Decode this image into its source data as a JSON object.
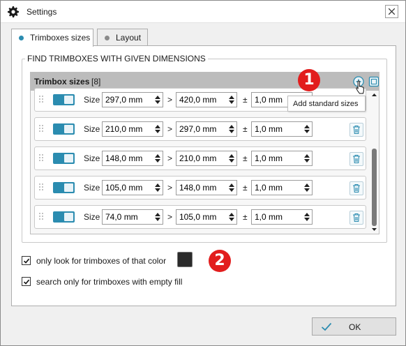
{
  "window": {
    "title": "Settings",
    "title_icon": "gear-icon",
    "close_icon": "close-icon"
  },
  "tabs": [
    {
      "label": "Trimboxes sizes",
      "active": true,
      "dot_color": "#2b8cb0"
    },
    {
      "label": "Layout",
      "active": false,
      "dot_color": "#8a8a8a"
    }
  ],
  "find_group": {
    "title": "FIND TRIMBOXES WITH GIVEN DIMENSIONS",
    "list": {
      "title": "Trimbox sizes",
      "count": "[8]",
      "add_icon": "add-circle-icon",
      "standard_icon": "add-standard-sizes-icon",
      "rows": [
        {
          "label": "Size",
          "width": "297,0 mm",
          "separator": ">",
          "height": "420,0 mm",
          "tolerance_sign": "±",
          "tolerance": "1,0 mm"
        },
        {
          "label": "Size",
          "width": "210,0 mm",
          "separator": ">",
          "height": "297,0 mm",
          "tolerance_sign": "±",
          "tolerance": "1,0 mm"
        },
        {
          "label": "Size",
          "width": "148,0 mm",
          "separator": ">",
          "height": "210,0 mm",
          "tolerance_sign": "±",
          "tolerance": "1,0 mm"
        },
        {
          "label": "Size",
          "width": "105,0 mm",
          "separator": ">",
          "height": "148,0 mm",
          "tolerance_sign": "±",
          "tolerance": "1,0 mm"
        },
        {
          "label": "Size",
          "width": "74,0 mm",
          "separator": ">",
          "height": "105,0 mm",
          "tolerance_sign": "±",
          "tolerance": "1,0 mm"
        }
      ]
    }
  },
  "tooltip": {
    "text": "Add standard sizes"
  },
  "callouts": {
    "one": "1",
    "two": "2",
    "color": "#e21d1d"
  },
  "options": {
    "color_only": {
      "label": "only look for trimboxes of that color",
      "checked": true,
      "swatch_color": "#2b2b2b"
    },
    "empty_fill": {
      "label": "search only for trimboxes with empty fill",
      "checked": true
    }
  },
  "footer": {
    "ok_label": "OK",
    "ok_icon": "check-icon"
  },
  "colors": {
    "accent": "#2b8cb0",
    "header_bg": "#bcbcbc"
  }
}
